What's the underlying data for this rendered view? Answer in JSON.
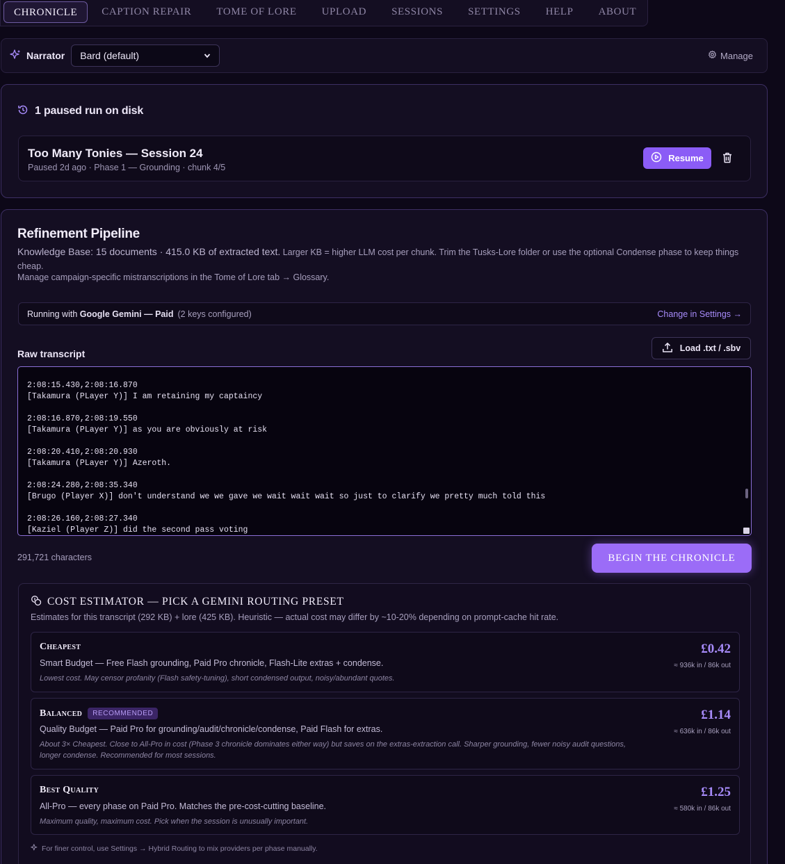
{
  "nav": {
    "tabs": [
      "CHRONICLE",
      "CAPTION REPAIR",
      "TOME OF LORE",
      "UPLOAD",
      "SESSIONS",
      "SETTINGS",
      "HELP",
      "ABOUT"
    ],
    "active": "CHRONICLE"
  },
  "narrator": {
    "label": "Narrator",
    "selected": "Bard (default)",
    "manage": "Manage"
  },
  "paused": {
    "title": "1 paused run on disk",
    "run_title": "Too Many Tonies — Session 24",
    "run_meta": "Paused 2d ago · Phase 1 — Grounding · chunk 4/5",
    "resume": "Resume"
  },
  "pipeline": {
    "title": "Refinement Pipeline",
    "kb_main": "Knowledge Base: 15 documents · 415.0 KB of extracted text.",
    "kb_note": "Larger KB = higher LLM cost per chunk. Trim the Tusks-Lore folder or use the optional Condense phase to keep things cheap.",
    "manage_note": "Manage campaign-specific mistranscriptions in the Tome of Lore tab → Glossary.",
    "running_prefix": "Running with",
    "running_provider": "Google Gemini — Paid",
    "running_keys": "(2 keys configured)",
    "change_link": "Change in Settings →",
    "raw_label": "Raw transcript",
    "load_button": "Load .txt / .sbv",
    "transcript": "2:08:15.430,2:08:16.870\n[Takamura (PLayer Y)] I am retaining my captaincy\n\n2:08:16.870,2:08:19.550\n[Takamura (PLayer Y)] as you are obviously at risk\n\n2:08:20.410,2:08:20.930\n[Takamura (PLayer Y)] Azeroth.\n\n2:08:24.280,2:08:35.340\n[Brugo (Player X)] don't understand we we gave we wait wait wait so just to clarify we pretty much told this\n\n2:08:26.160,2:08:27.340\n[Kaziel (Player Z)] did the second pass voting",
    "char_count": "291,721 characters",
    "begin_button": "BEGIN THE CHRONICLE"
  },
  "cost": {
    "title": "COST ESTIMATOR — PICK A GEMINI ROUTING PRESET",
    "subtitle": "Estimates for this transcript (292 KB) + lore (425 KB). Heuristic — actual cost may differ by ~10-20% depending on prompt-cache hit rate.",
    "presets": [
      {
        "name": "Cheapest",
        "badge": "",
        "line": "Smart Budget — Free Flash grounding, Paid Pro chronicle, Flash-Lite extras + condense.",
        "note": "Lowest cost. May censor profanity (Flash safety-tuning), short condensed output, noisy/abundant quotes.",
        "price": "£0.42",
        "tokens": "≈ 936k in / 86k out"
      },
      {
        "name": "Balanced",
        "badge": "RECOMMENDED",
        "line": "Quality Budget — Paid Pro for grounding/audit/chronicle/condense, Paid Flash for extras.",
        "note": "About 3× Cheapest. Close to All-Pro in cost (Phase 3 chronicle dominates either way) but saves on the extras-extraction call. Sharper grounding, fewer noisy audit questions, longer condense. Recommended for most sessions.",
        "price": "£1.14",
        "tokens": "≈ 636k in / 86k out"
      },
      {
        "name": "Best Quality",
        "badge": "",
        "line": "All-Pro — every phase on Paid Pro. Matches the pre-cost-cutting baseline.",
        "note": "Maximum quality, maximum cost. Pick when the session is unusually important.",
        "price": "£1.25",
        "tokens": "≈ 580k in / 86k out"
      }
    ],
    "finer": "For finer control, use Settings → Hybrid Routing to mix providers per phase manually."
  },
  "colors": {
    "accent": "#8b5cf6",
    "background": "#0d0818",
    "card": "#140e22",
    "price": "#a78bfa"
  }
}
